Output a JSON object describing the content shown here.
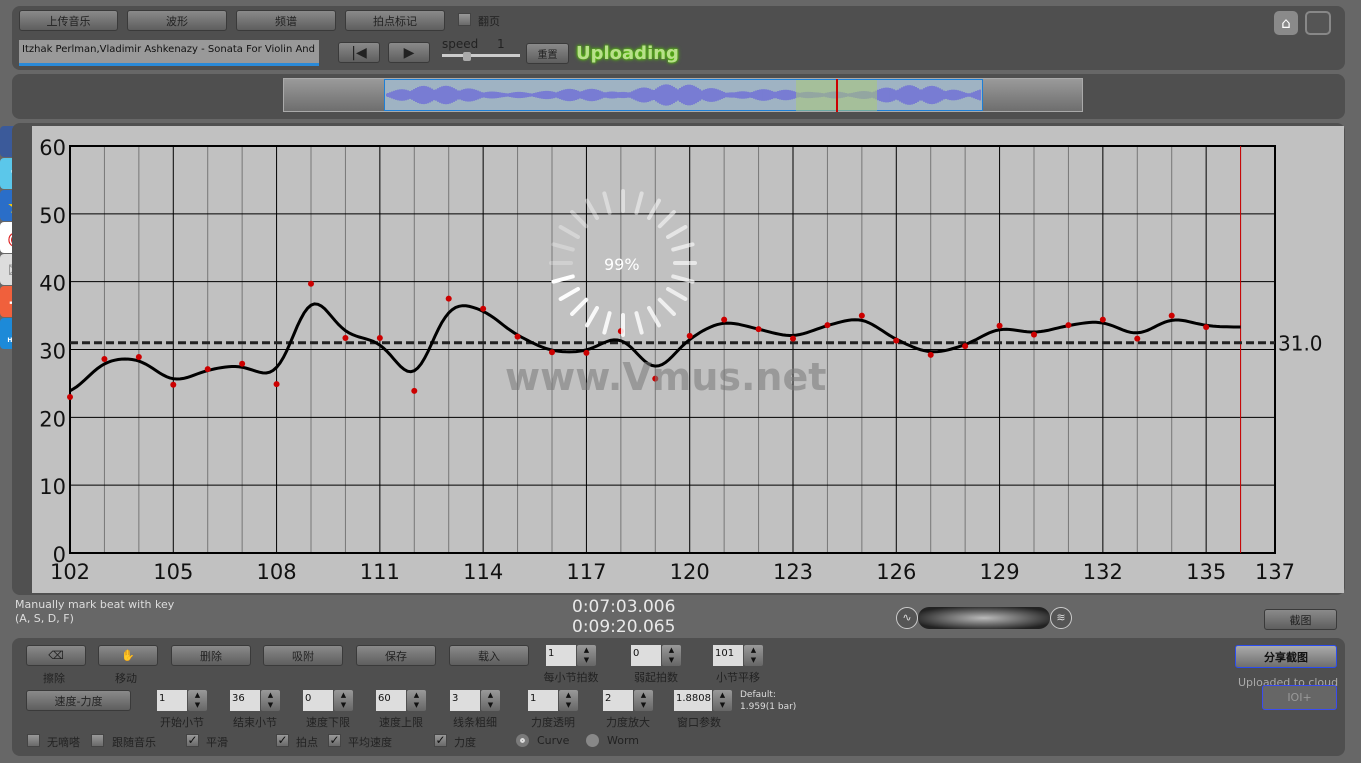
{
  "toolbar": {
    "upload_music": "上传音乐",
    "waveform": "波形",
    "spectrum": "频谱",
    "beat_mark": "拍点标记",
    "page_turn": "翻页",
    "page_turn_checked": false
  },
  "track": {
    "title": "Itzhak Perlman,Vladimir Ashkenazy - Sonata For Violin And Piano"
  },
  "playback": {
    "speed_label": "speed",
    "speed_value": "1",
    "reset": "重置",
    "status": "Uploading"
  },
  "top_icons": [
    "home-icon",
    "fullscreen-icon"
  ],
  "social": [
    "facebook",
    "twitter",
    "qzone",
    "weibo",
    "email",
    "add",
    "help"
  ],
  "social_help": "HELP",
  "loading": {
    "percent": "99%"
  },
  "watermark": "www.Vmus.net",
  "chart_data": {
    "type": "scatter",
    "x": [
      102,
      103,
      104,
      105,
      106,
      107,
      108,
      109,
      110,
      111,
      112,
      113,
      114,
      115,
      116,
      117,
      118,
      119,
      120,
      121,
      122,
      123,
      124,
      125,
      126,
      127,
      128,
      129,
      130,
      131,
      132,
      133,
      134,
      135
    ],
    "y": [
      23.0,
      28.6,
      28.9,
      24.8,
      27.1,
      27.9,
      24.9,
      39.7,
      31.7,
      31.7,
      23.9,
      37.5,
      36.0,
      31.9,
      29.6,
      29.5,
      32.7,
      25.7,
      32.0,
      34.4,
      33.0,
      31.6,
      33.6,
      35.0,
      31.3,
      29.2,
      30.5,
      33.5,
      32.2,
      33.6,
      34.4,
      31.6,
      35.0,
      33.3
    ],
    "xlim": [
      102,
      137
    ],
    "ylim": [
      0,
      60
    ],
    "xticks": [
      "102",
      "105",
      "108",
      "111",
      "114",
      "117",
      "120",
      "123",
      "126",
      "129",
      "132",
      "135",
      "137"
    ],
    "yticks": [
      "0",
      "10",
      "20",
      "30",
      "40",
      "50",
      "60"
    ],
    "average": 31.0,
    "average_label": "31.0",
    "current_position": 136,
    "point_color": "#cc0000",
    "curve_color": "#000000",
    "grid": true
  },
  "hint": {
    "line1": "Manually mark beat with key",
    "line2": "(A, S, D, F)"
  },
  "time": {
    "current": "0:07:03.006",
    "total": "0:09:20.065"
  },
  "screenshot_btn": "截图",
  "controls": {
    "erase": "擦除",
    "move": "移动",
    "delete": "删除",
    "snap": "吸附",
    "save": "保存",
    "load": "载入",
    "beats_per_bar": {
      "value": "1",
      "label": "每小节拍数"
    },
    "pickup_beats": {
      "value": "0",
      "label": "弱起拍数"
    },
    "bar_offset": {
      "value": "101",
      "label": "小节平移"
    },
    "tempo_dynamics": "速度-力度",
    "start_bar": {
      "value": "1",
      "label": "开始小节"
    },
    "end_bar": {
      "value": "36",
      "label": "结束小节"
    },
    "tempo_min": {
      "value": "0",
      "label": "速度下限"
    },
    "tempo_max": {
      "value": "60",
      "label": "速度上限"
    },
    "line_width": {
      "value": "3",
      "label": "线条粗细"
    },
    "dyn_opacity": {
      "value": "1",
      "label": "力度透明"
    },
    "dyn_scale": {
      "value": "2",
      "label": "力度放大"
    },
    "window_param": {
      "value": "1.8808",
      "label": "窗口参数"
    },
    "default_line1": "Default:",
    "default_line2": "1.959(1 bar)",
    "checks": [
      {
        "label": "无嘀嗒",
        "checked": false
      },
      {
        "label": "跟随音乐",
        "checked": false
      },
      {
        "label": "平滑",
        "checked": true
      },
      {
        "label": "拍点",
        "checked": true
      },
      {
        "label": "平均速度",
        "checked": true
      },
      {
        "label": "力度",
        "checked": true
      }
    ],
    "radios": [
      {
        "label": "Curve",
        "selected": true
      },
      {
        "label": "Worm",
        "selected": false
      }
    ]
  },
  "share": {
    "share_screenshot": "分享截图",
    "uploaded": "Uploaded to cloud",
    "ioi": "IOI+"
  }
}
